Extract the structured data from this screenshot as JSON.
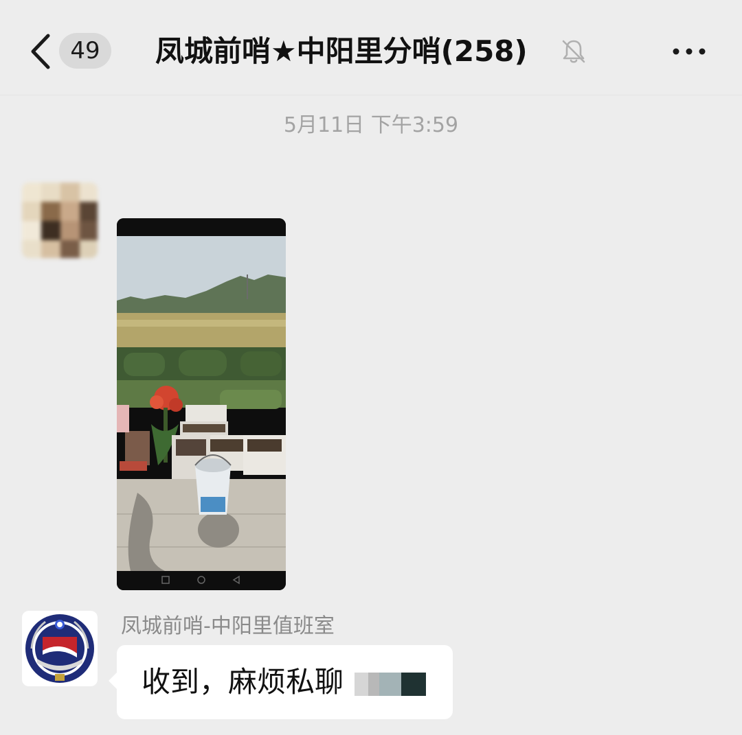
{
  "header": {
    "back_icon": "chevron-left-icon",
    "unread_count": "49",
    "title": "凤城前哨★中阳里分哨(258)",
    "mute_icon": "bell-off-icon",
    "more_icon": "more-horizontal-icon"
  },
  "timestamp": "5月11日 下午3:59",
  "messages": [
    {
      "type": "image",
      "avatar": "blurred-user-avatar",
      "image": "photo of farmland, potted plants and a bucket on a patio"
    },
    {
      "type": "text",
      "sender": "凤城前哨-中阳里值班室",
      "avatar": "police-emblem-avatar",
      "text": "收到，麻烦私聊"
    }
  ],
  "colors": {
    "background": "#ededed",
    "bubble": "#ffffff",
    "timestamp": "#a3a3a3",
    "sender_name": "#8a8a8a",
    "badge": "#d9d9d9"
  }
}
